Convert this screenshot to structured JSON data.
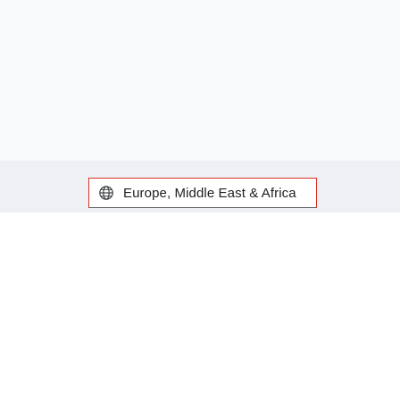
{
  "region_selector": {
    "selected_label": "Europe, Middle East & Africa",
    "icon": "globe-icon",
    "border_color": "#d93025"
  },
  "colors": {
    "background": "#f8f9fb",
    "band": "#eef0f3",
    "text": "#202124"
  }
}
